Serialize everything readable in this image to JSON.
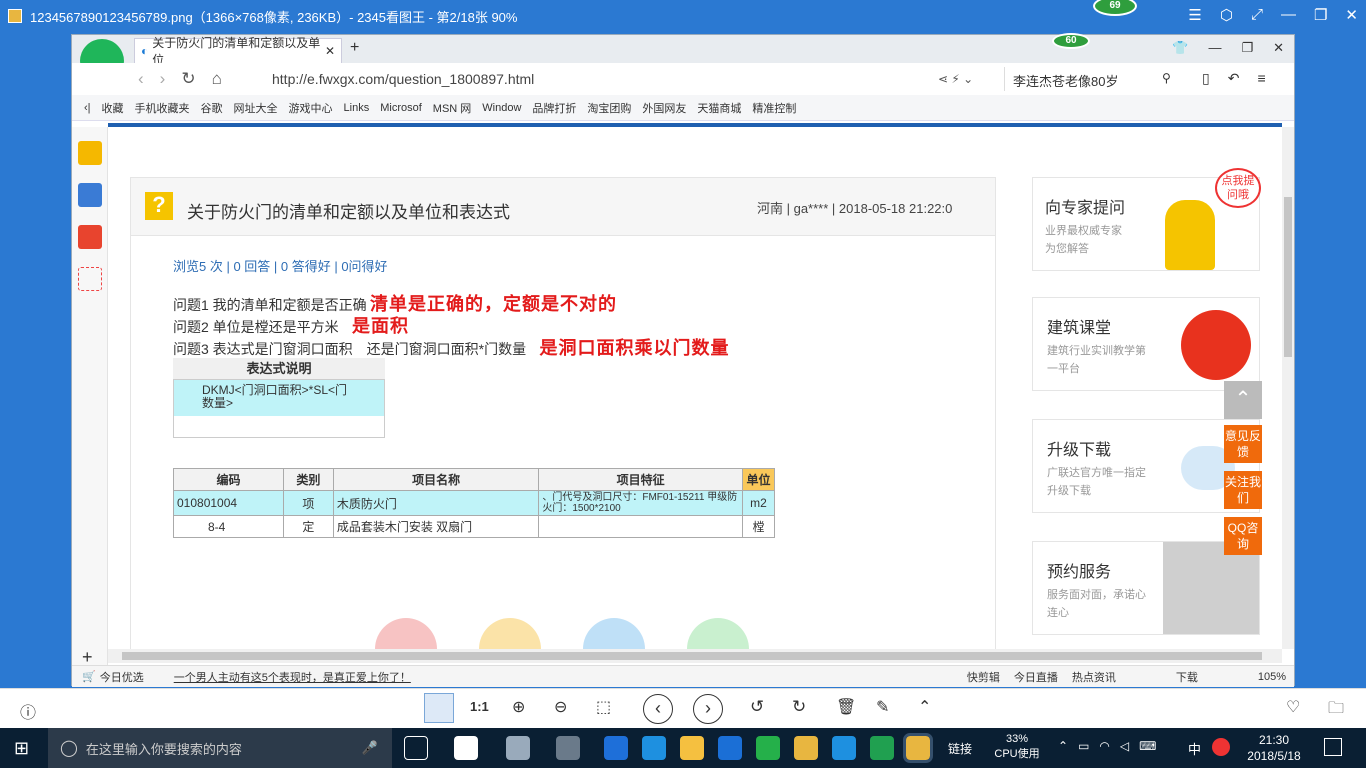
{
  "viewer": {
    "title": "1234567890123456789.png（1366×768像素, 236KB）- 2345看图王 - 第2/18张 90%",
    "badge1": "69",
    "badge2": "60"
  },
  "browser": {
    "tab_title": "关于防火门的清单和定额以及单位",
    "url": "http://e.fwxgx.com/question_1800897.html",
    "search_text": "李连杰苍老像80岁",
    "bookmarks": [
      "收藏",
      "手机收藏夹",
      "谷歌",
      "网址大全",
      "游戏中心",
      "Links",
      "Microsof",
      "MSN 网",
      "Window",
      "品牌打折",
      "淘宝团购",
      "外国网友",
      "天猫商城",
      "精准控制"
    ]
  },
  "question": {
    "title": "关于防火门的清单和定额以及单位和表达式",
    "meta": "河南 |  ga**** | 2018-05-18 21:22:0",
    "stats": "浏览5 次 | 0 回答 | 0 答得好 | 0问得好",
    "q1": "问题1 我的清单和定额是否正确",
    "a1": "清单是正确的，定额是不对的",
    "q2": "问题2 单位是樘还是平方米",
    "a2": "是面积",
    "q3": "问题3 表达式是门窗洞口面积　还是门窗洞口面积*门数量",
    "a3": "是洞口面积乘以门数量",
    "expr_header": "表达式说明",
    "expr_value": "DKMJ<门洞口面积>*SL<门数量>",
    "table_headers": [
      "编码",
      "类别",
      "项目名称",
      "项目特征",
      "单位"
    ],
    "table_rows": [
      [
        "010801004",
        "项",
        "木质防火门",
        "、门代号及洞口尺寸：FMF01-15211 甲级防火门：1500*2100",
        "m2"
      ],
      [
        "8-4",
        "定",
        "成品套装木门安装 双扇门",
        "",
        "樘"
      ]
    ]
  },
  "right": {
    "expert_title": "向专家提问",
    "expert_sub": "业界最权威专家为您解答",
    "bubble": "点我提问哦",
    "course_title": "建筑课堂",
    "course_sub": "建筑行业实训教学第一平台",
    "upgrade_title": "升级下载",
    "upgrade_sub": "广联达官方唯一指定升级下载",
    "service_title": "预约服务",
    "service_sub": "服务面对面，承诺心连心",
    "float": [
      "意见反馈",
      "关注我们",
      "QQ咨询"
    ]
  },
  "status": {
    "left": "今日优选",
    "news": "一个男人主动有这5个表现时，是真正爱上你了！",
    "items": [
      "快剪辑",
      "今日直播",
      "热点资讯",
      "下载",
      "105%"
    ]
  },
  "taskbar": {
    "search_placeholder": "在这里输入你要搜索的内容",
    "link": "链接",
    "cpu_pct": "33%",
    "cpu_label": "CPU使用",
    "ime": "中",
    "time": "21:30",
    "date": "2018/5/18"
  },
  "toolbar": {
    "ratio": "1:1"
  }
}
